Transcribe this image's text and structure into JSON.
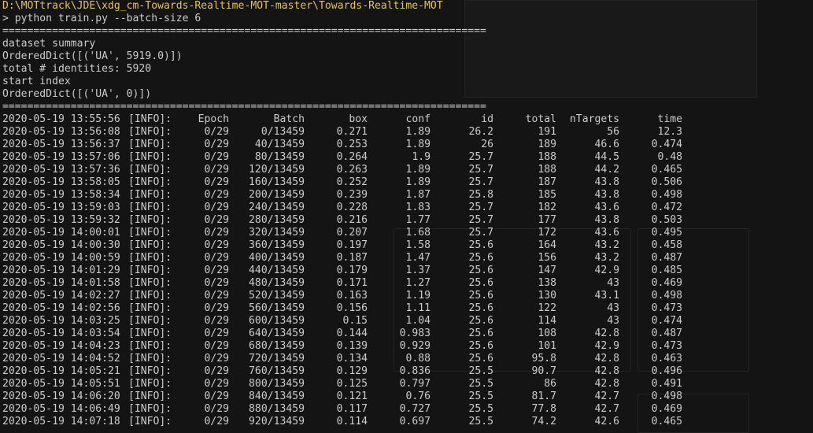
{
  "terminal": {
    "cwd_path": "D:\\MOTtrack\\JDE\\xdg_cm-Towards-Realtime-MOT-master\\Towards-Realtime-MOT",
    "command": "> python train.py --batch-size 6",
    "separator": "==============================================================================",
    "summary_lines": [
      "dataset summary",
      "OrderedDict([('UA', 5919.0)])",
      "total # identities: 5920",
      "start index",
      "OrderedDict([('UA', 0)])"
    ],
    "header": {
      "timestamp": "2020-05-19 13:55:56",
      "level": "[INFO]:",
      "epoch": "Epoch",
      "batch": "Batch",
      "box": "box",
      "conf": "conf",
      "id": "id",
      "total": "total",
      "ntargets": "nTargets",
      "time": "time"
    },
    "rows": [
      {
        "timestamp": "2020-05-19 13:56:08",
        "level": "[INFO]:",
        "epoch": "0/29",
        "batch": "0/13459",
        "box": "0.271",
        "conf": "1.89",
        "id": "26.2",
        "total": "191",
        "ntargets": "56",
        "time": "12.3"
      },
      {
        "timestamp": "2020-05-19 13:56:37",
        "level": "[INFO]:",
        "epoch": "0/29",
        "batch": "40/13459",
        "box": "0.253",
        "conf": "1.89",
        "id": "26",
        "total": "189",
        "ntargets": "46.6",
        "time": "0.474"
      },
      {
        "timestamp": "2020-05-19 13:57:06",
        "level": "[INFO]:",
        "epoch": "0/29",
        "batch": "80/13459",
        "box": "0.264",
        "conf": "1.9",
        "id": "25.7",
        "total": "188",
        "ntargets": "44.5",
        "time": "0.48"
      },
      {
        "timestamp": "2020-05-19 13:57:36",
        "level": "[INFO]:",
        "epoch": "0/29",
        "batch": "120/13459",
        "box": "0.263",
        "conf": "1.89",
        "id": "25.7",
        "total": "188",
        "ntargets": "44.2",
        "time": "0.465"
      },
      {
        "timestamp": "2020-05-19 13:58:05",
        "level": "[INFO]:",
        "epoch": "0/29",
        "batch": "160/13459",
        "box": "0.252",
        "conf": "1.89",
        "id": "25.7",
        "total": "187",
        "ntargets": "43.8",
        "time": "0.506"
      },
      {
        "timestamp": "2020-05-19 13:58:34",
        "level": "[INFO]:",
        "epoch": "0/29",
        "batch": "200/13459",
        "box": "0.239",
        "conf": "1.87",
        "id": "25.8",
        "total": "185",
        "ntargets": "43.8",
        "time": "0.498"
      },
      {
        "timestamp": "2020-05-19 13:59:03",
        "level": "[INFO]:",
        "epoch": "0/29",
        "batch": "240/13459",
        "box": "0.228",
        "conf": "1.83",
        "id": "25.7",
        "total": "182",
        "ntargets": "43.6",
        "time": "0.472"
      },
      {
        "timestamp": "2020-05-19 13:59:32",
        "level": "[INFO]:",
        "epoch": "0/29",
        "batch": "280/13459",
        "box": "0.216",
        "conf": "1.77",
        "id": "25.7",
        "total": "177",
        "ntargets": "43.8",
        "time": "0.503"
      },
      {
        "timestamp": "2020-05-19 14:00:01",
        "level": "[INFO]:",
        "epoch": "0/29",
        "batch": "320/13459",
        "box": "0.207",
        "conf": "1.68",
        "id": "25.7",
        "total": "172",
        "ntargets": "43.6",
        "time": "0.495"
      },
      {
        "timestamp": "2020-05-19 14:00:30",
        "level": "[INFO]:",
        "epoch": "0/29",
        "batch": "360/13459",
        "box": "0.197",
        "conf": "1.58",
        "id": "25.6",
        "total": "164",
        "ntargets": "43.2",
        "time": "0.458"
      },
      {
        "timestamp": "2020-05-19 14:00:59",
        "level": "[INFO]:",
        "epoch": "0/29",
        "batch": "400/13459",
        "box": "0.187",
        "conf": "1.47",
        "id": "25.6",
        "total": "156",
        "ntargets": "43.2",
        "time": "0.487"
      },
      {
        "timestamp": "2020-05-19 14:01:29",
        "level": "[INFO]:",
        "epoch": "0/29",
        "batch": "440/13459",
        "box": "0.179",
        "conf": "1.37",
        "id": "25.6",
        "total": "147",
        "ntargets": "42.9",
        "time": "0.485"
      },
      {
        "timestamp": "2020-05-19 14:01:58",
        "level": "[INFO]:",
        "epoch": "0/29",
        "batch": "480/13459",
        "box": "0.171",
        "conf": "1.27",
        "id": "25.6",
        "total": "138",
        "ntargets": "43",
        "time": "0.469"
      },
      {
        "timestamp": "2020-05-19 14:02:27",
        "level": "[INFO]:",
        "epoch": "0/29",
        "batch": "520/13459",
        "box": "0.163",
        "conf": "1.19",
        "id": "25.6",
        "total": "130",
        "ntargets": "43.1",
        "time": "0.498"
      },
      {
        "timestamp": "2020-05-19 14:02:56",
        "level": "[INFO]:",
        "epoch": "0/29",
        "batch": "560/13459",
        "box": "0.156",
        "conf": "1.11",
        "id": "25.6",
        "total": "122",
        "ntargets": "43",
        "time": "0.473"
      },
      {
        "timestamp": "2020-05-19 14:03:25",
        "level": "[INFO]:",
        "epoch": "0/29",
        "batch": "600/13459",
        "box": "0.15",
        "conf": "1.04",
        "id": "25.6",
        "total": "114",
        "ntargets": "43",
        "time": "0.474"
      },
      {
        "timestamp": "2020-05-19 14:03:54",
        "level": "[INFO]:",
        "epoch": "0/29",
        "batch": "640/13459",
        "box": "0.144",
        "conf": "0.983",
        "id": "25.6",
        "total": "108",
        "ntargets": "42.8",
        "time": "0.487"
      },
      {
        "timestamp": "2020-05-19 14:04:23",
        "level": "[INFO]:",
        "epoch": "0/29",
        "batch": "680/13459",
        "box": "0.139",
        "conf": "0.929",
        "id": "25.6",
        "total": "101",
        "ntargets": "42.9",
        "time": "0.473"
      },
      {
        "timestamp": "2020-05-19 14:04:52",
        "level": "[INFO]:",
        "epoch": "0/29",
        "batch": "720/13459",
        "box": "0.134",
        "conf": "0.88",
        "id": "25.6",
        "total": "95.8",
        "ntargets": "42.8",
        "time": "0.463"
      },
      {
        "timestamp": "2020-05-19 14:05:21",
        "level": "[INFO]:",
        "epoch": "0/29",
        "batch": "760/13459",
        "box": "0.129",
        "conf": "0.836",
        "id": "25.5",
        "total": "90.7",
        "ntargets": "42.8",
        "time": "0.496"
      },
      {
        "timestamp": "2020-05-19 14:05:51",
        "level": "[INFO]:",
        "epoch": "0/29",
        "batch": "800/13459",
        "box": "0.125",
        "conf": "0.797",
        "id": "25.5",
        "total": "86",
        "ntargets": "42.8",
        "time": "0.491"
      },
      {
        "timestamp": "2020-05-19 14:06:20",
        "level": "[INFO]:",
        "epoch": "0/29",
        "batch": "840/13459",
        "box": "0.121",
        "conf": "0.76",
        "id": "25.5",
        "total": "81.7",
        "ntargets": "42.7",
        "time": "0.498"
      },
      {
        "timestamp": "2020-05-19 14:06:49",
        "level": "[INFO]:",
        "epoch": "0/29",
        "batch": "880/13459",
        "box": "0.117",
        "conf": "0.727",
        "id": "25.5",
        "total": "77.8",
        "ntargets": "42.7",
        "time": "0.469"
      },
      {
        "timestamp": "2020-05-19 14:07:18",
        "level": "[INFO]:",
        "epoch": "0/29",
        "batch": "920/13459",
        "box": "0.114",
        "conf": "0.697",
        "id": "25.5",
        "total": "74.2",
        "ntargets": "42.6",
        "time": "0.465"
      }
    ]
  },
  "colors": {
    "background": "#141414",
    "text": "#cccccc",
    "path": "#e6c35a"
  }
}
